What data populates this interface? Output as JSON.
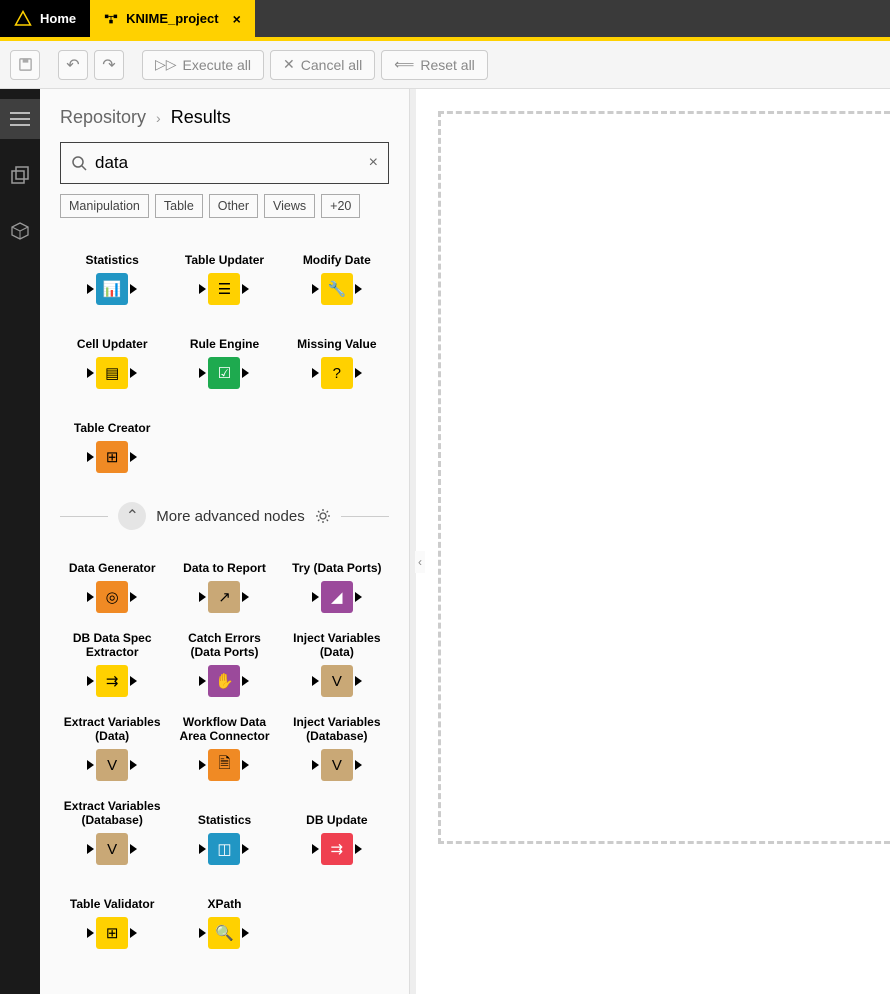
{
  "tabs": {
    "home": "Home",
    "project": "KNIME_project"
  },
  "toolbar": {
    "execute": "Execute all",
    "cancel": "Cancel all",
    "reset": "Reset all"
  },
  "breadcrumb": {
    "root": "Repository",
    "current": "Results"
  },
  "search": {
    "value": "data"
  },
  "tags": [
    "Manipulation",
    "Table",
    "Other",
    "Views",
    "+20"
  ],
  "advanced": {
    "label": "More advanced nodes"
  },
  "nodes_basic": [
    {
      "label": "Statistics",
      "color": "#2196c4",
      "glyph": "📊"
    },
    {
      "label": "Table Updater",
      "color": "#ffd100",
      "glyph": "☰"
    },
    {
      "label": "Modify Date",
      "color": "#ffd100",
      "glyph": "🔧"
    },
    {
      "label": "Cell Updater",
      "color": "#ffd100",
      "glyph": "▤"
    },
    {
      "label": "Rule Engine",
      "color": "#1eaa4f",
      "glyph": "☑"
    },
    {
      "label": "Missing Value",
      "color": "#ffd100",
      "glyph": "?"
    },
    {
      "label": "Table Creator",
      "color": "#f08a24",
      "glyph": "⊞"
    }
  ],
  "nodes_adv": [
    {
      "label": "Data Generator",
      "color": "#f08a24",
      "glyph": "◎"
    },
    {
      "label": "Data to Report",
      "color": "#c9a876",
      "glyph": "↗"
    },
    {
      "label": "Try (Data Ports)",
      "color": "#9b4a9b",
      "glyph": "◢"
    },
    {
      "label": "DB Data Spec Extractor",
      "color": "#ffd100",
      "glyph": "⇉"
    },
    {
      "label": "Catch Errors (Data Ports)",
      "color": "#9b4a9b",
      "glyph": "✋"
    },
    {
      "label": "Inject Variables (Data)",
      "color": "#c9a876",
      "glyph": "V"
    },
    {
      "label": "Extract Variables (Data)",
      "color": "#c9a876",
      "glyph": "V"
    },
    {
      "label": "Workflow Data Area Connector",
      "color": "#f08a24",
      "glyph": "🗎"
    },
    {
      "label": "Inject Variables (Database)",
      "color": "#c9a876",
      "glyph": "V"
    },
    {
      "label": "Extract Variables (Database)",
      "color": "#c9a876",
      "glyph": "V"
    },
    {
      "label": "Statistics",
      "color": "#2196c4",
      "glyph": "◫"
    },
    {
      "label": "DB Update",
      "color": "#ef4050",
      "glyph": "⇉"
    },
    {
      "label": "Table Validator",
      "color": "#ffd100",
      "glyph": "⊞"
    },
    {
      "label": "XPath",
      "color": "#ffd100",
      "glyph": "🔍"
    }
  ]
}
